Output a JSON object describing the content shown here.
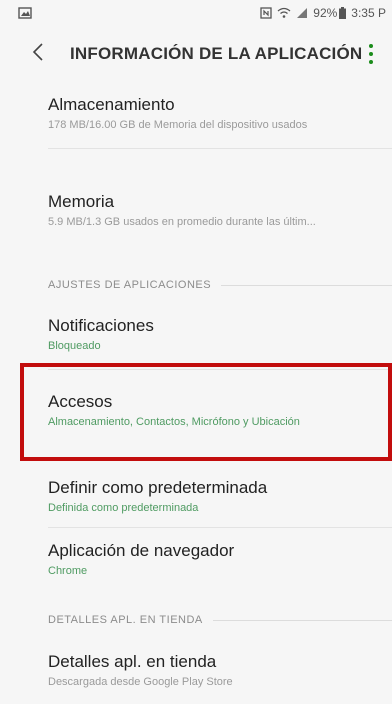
{
  "status_bar": {
    "battery": "92%",
    "time": "3:35 P"
  },
  "header": {
    "title": "INFORMACIÓN DE LA APLICACIÓN",
    "back_icon": "chevron-left-icon",
    "more_icon": "more-vert-icon"
  },
  "items": [
    {
      "title": "Almacenamiento",
      "subtitle": "178 MB/16.00 GB de Memoria del dispositivo usados"
    },
    {
      "title": "Memoria",
      "subtitle": "5.9 MB/1.3 GB usados en promedio durante las últim..."
    },
    {
      "title": "Notificaciones",
      "subtitle": "Bloqueado"
    },
    {
      "title": "Accesos",
      "subtitle": "Almacenamiento, Contactos, Micrófono y Ubicación"
    },
    {
      "title": "Definir como predeterminada",
      "subtitle": "Definida como predeterminada"
    },
    {
      "title": "Aplicación de navegador",
      "subtitle": "Chrome"
    },
    {
      "title": "Detalles apl. en tienda",
      "subtitle": "Descargada desde Google Play Store"
    }
  ],
  "sections": {
    "app_settings": "AJUSTES DE APLICACIONES",
    "store_details": "DETALLES APL. EN TIENDA"
  },
  "colors": {
    "accent_green": "#4f9b62",
    "highlight_red": "#c20d0d"
  }
}
